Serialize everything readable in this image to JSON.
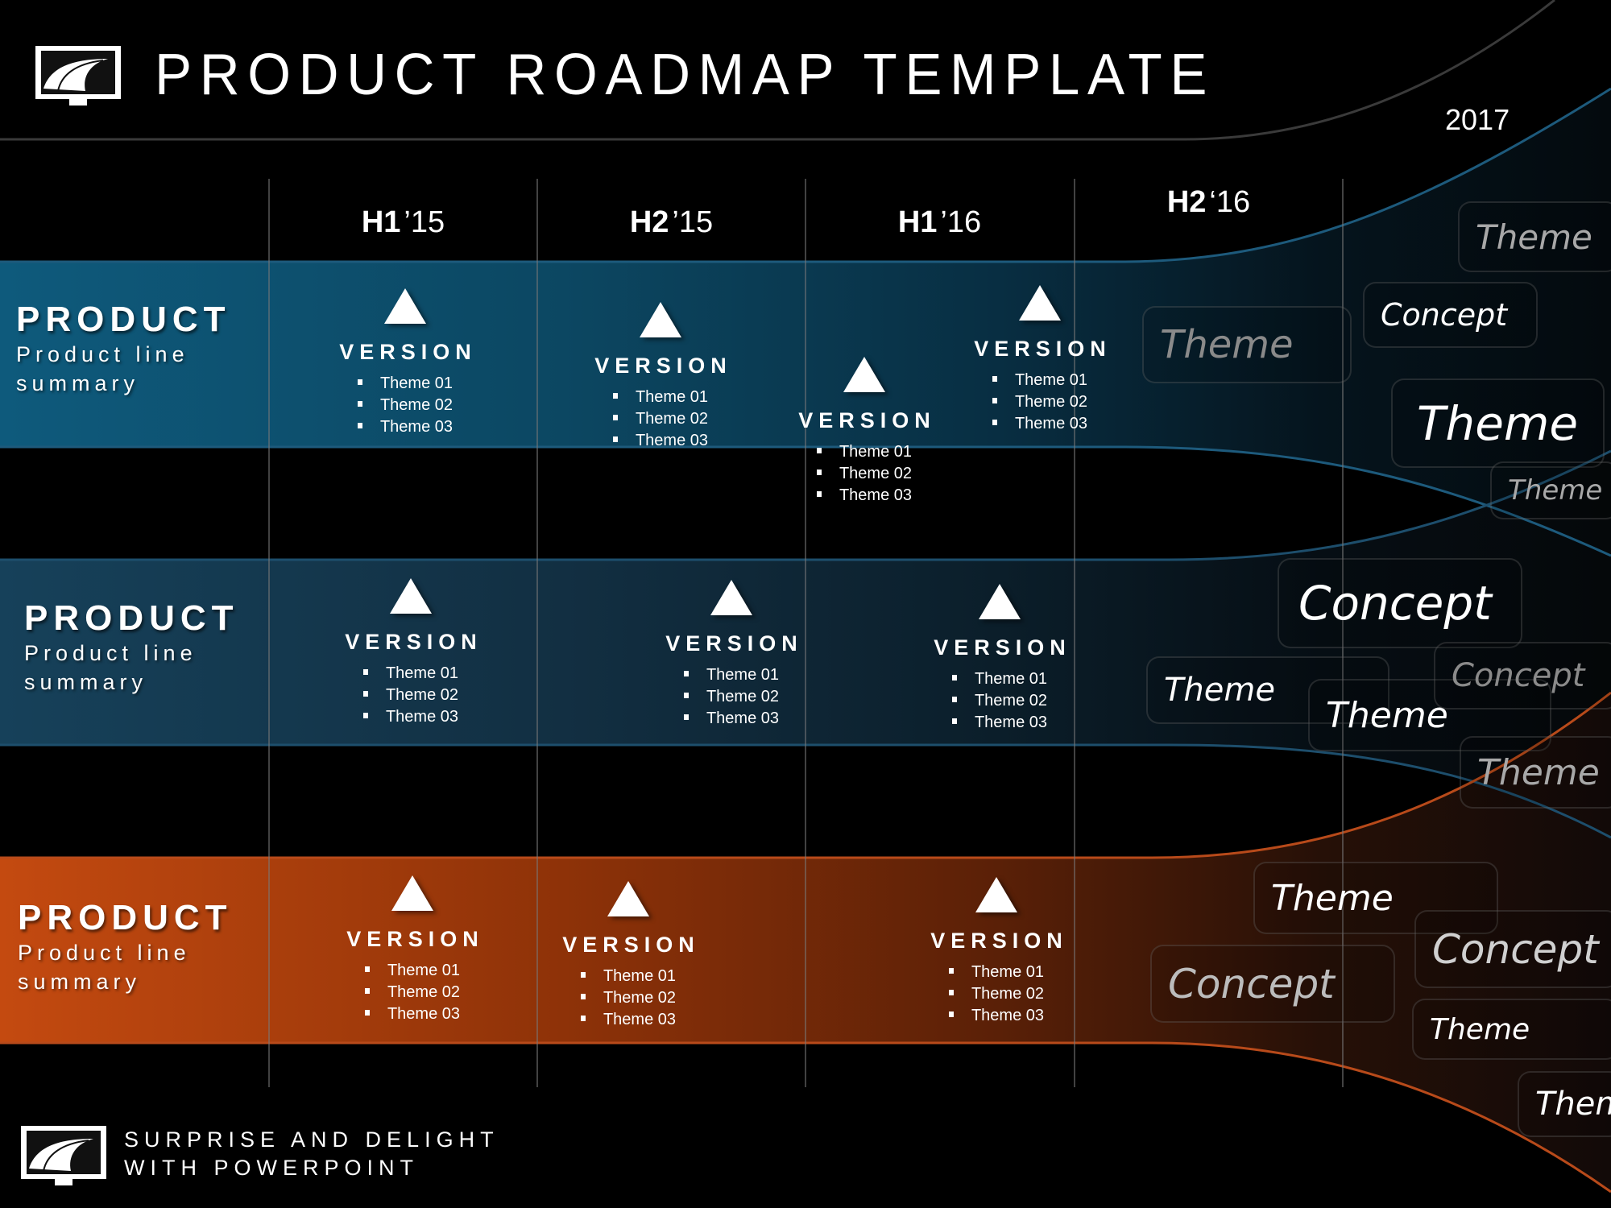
{
  "header": {
    "title": "PRODUCT ROADMAP TEMPLATE",
    "year": "2017",
    "logo_icon": "road-monitor-icon"
  },
  "columns": [
    {
      "half": "H1",
      "year": "’15"
    },
    {
      "half": "H2",
      "year": "’15"
    },
    {
      "half": "H1",
      "year": "’16"
    },
    {
      "half": "H2",
      "year": "‘16"
    }
  ],
  "colors": {
    "band_blue_1": "#0e5a7c",
    "band_blue_2": "#14415a",
    "band_orange": "#c44a10",
    "curve_blue": "#1d5a7c",
    "curve_orange": "#b84a1a",
    "curve_grey": "#3a3a3a",
    "grid_line": "#3c3c3c"
  },
  "products": [
    {
      "title": "PRODUCT",
      "subtitle": "Product line summary",
      "versions": [
        {
          "label": "VERSION",
          "themes": [
            "Theme 01",
            "Theme 02",
            "Theme 03"
          ]
        },
        {
          "label": "VERSION",
          "themes": [
            "Theme 01",
            "Theme 02",
            "Theme 03"
          ]
        },
        {
          "label": "VERSION",
          "themes": [
            "Theme 01",
            "Theme 02",
            "Theme 03"
          ]
        },
        {
          "label": "VERSION",
          "themes": [
            "Theme 01",
            "Theme 02",
            "Theme 03"
          ]
        }
      ]
    },
    {
      "title": "PRODUCT",
      "subtitle": "Product line summary",
      "versions": [
        {
          "label": "VERSION",
          "themes": [
            "Theme 01",
            "Theme 02",
            "Theme 03"
          ]
        },
        {
          "label": "VERSION",
          "themes": [
            "Theme 01",
            "Theme 02",
            "Theme 03"
          ]
        },
        {
          "label": "VERSION",
          "themes": [
            "Theme 01",
            "Theme 02",
            "Theme 03"
          ]
        }
      ]
    },
    {
      "title": "PRODUCT",
      "subtitle": "Product line summary",
      "versions": [
        {
          "label": "VERSION",
          "themes": [
            "Theme 01",
            "Theme 02",
            "Theme 03"
          ]
        },
        {
          "label": "VERSION",
          "themes": [
            "Theme 01",
            "Theme 02",
            "Theme 03"
          ]
        },
        {
          "label": "VERSION",
          "themes": [
            "Theme 01",
            "Theme 02",
            "Theme 03"
          ]
        }
      ]
    }
  ],
  "future_cloud": [
    "Theme",
    "Concept",
    "Theme",
    "Theme",
    "Theme",
    "Concept",
    "Theme",
    "Theme",
    "Concept",
    "Theme",
    "Theme",
    "Concept",
    "Concept",
    "Theme",
    "Theme"
  ],
  "footer": {
    "tagline_line1": "SURPRISE AND DELIGHT",
    "tagline_line2": "WITH POWERPOINT",
    "logo_icon": "road-monitor-icon"
  }
}
